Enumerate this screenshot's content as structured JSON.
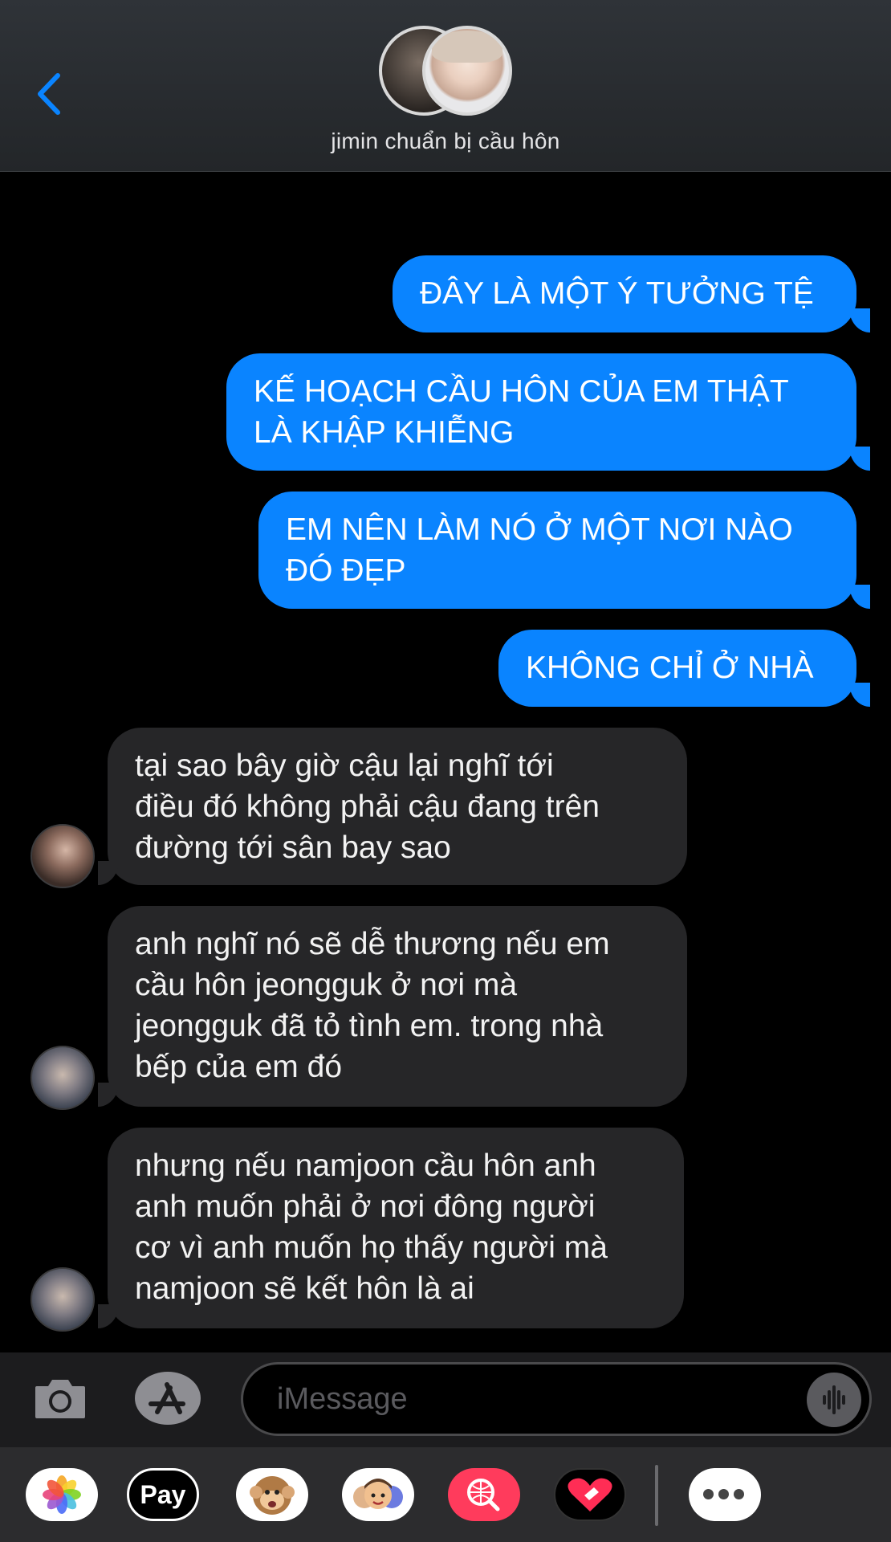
{
  "header": {
    "group_name": "jimin chuẩn bị cầu hôn"
  },
  "messages": [
    {
      "direction": "outgoing",
      "lines": [
        "ĐÂY LÀ MỘT Ý TƯỞNG TỆ"
      ]
    },
    {
      "direction": "outgoing",
      "lines": [
        "KẾ HOẠCH CẦU HÔN CỦA EM THẬT",
        "LÀ KHẬP KHIỄNG"
      ]
    },
    {
      "direction": "outgoing",
      "lines": [
        "EM NÊN LÀM NÓ Ở MỘT NƠI NÀO",
        "ĐÓ ĐẸP"
      ]
    },
    {
      "direction": "outgoing",
      "lines": [
        "KHÔNG CHỈ Ở NHÀ"
      ]
    },
    {
      "direction": "incoming",
      "lines": [
        "tại sao bây giờ cậu lại nghĩ tới",
        "điều đó không phải cậu đang trên",
        "đường tới sân bay sao"
      ]
    },
    {
      "direction": "incoming",
      "lines": [
        "anh nghĩ nó sẽ dễ thương nếu em",
        "cầu hôn jeongguk ở nơi mà",
        "jeongguk đã tỏ tình em. trong nhà",
        "bếp của em đó"
      ]
    },
    {
      "direction": "incoming",
      "lines": [
        "nhưng nếu namjoon cầu hôn anh",
        "anh muốn phải ở nơi đông người",
        "cơ vì anh muốn họ thấy người mà",
        "namjoon sẽ kết hôn là ai"
      ]
    }
  ],
  "composer": {
    "placeholder": "iMessage"
  },
  "app_drawer": {
    "apps": [
      "photos-icon",
      "apple-pay-icon",
      "animoji-icon",
      "memoji-icon",
      "web-search-icon",
      "digital-touch-icon",
      "more-icon"
    ],
    "apple_pay_label": "Pay"
  },
  "colors": {
    "outgoing_bubble": "#0a84ff",
    "incoming_bubble": "#262628",
    "background": "#000000"
  }
}
